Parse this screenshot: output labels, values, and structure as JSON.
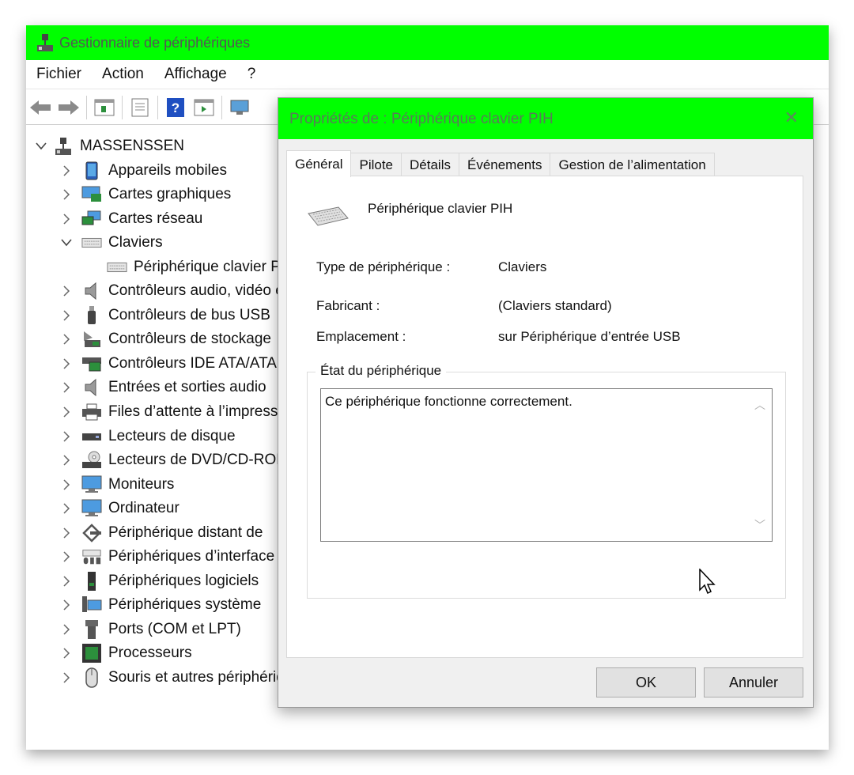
{
  "window": {
    "title": "Gestionnaire de périphériques",
    "accent": "#00ff00"
  },
  "menu": [
    "Fichier",
    "Action",
    "Affichage",
    "?"
  ],
  "toolbar": [
    "back-arrow-icon",
    "forward-arrow-icon",
    "properties-grid-icon",
    "document-icon",
    "help-icon",
    "run-panel-icon",
    "monitor-scan-icon"
  ],
  "tree": {
    "root": "MASSENSSEN",
    "items": [
      {
        "label": "Appareils mobiles",
        "icon": "phone-icon",
        "expanded": false
      },
      {
        "label": "Cartes graphiques",
        "icon": "display-adapter-icon",
        "expanded": false
      },
      {
        "label": "Cartes réseau",
        "icon": "network-icon",
        "expanded": false
      },
      {
        "label": "Claviers",
        "icon": "keyboard-icon",
        "expanded": true
      },
      {
        "label": "Périphérique clavier PIH",
        "icon": "keyboard-icon",
        "child": true
      },
      {
        "label": "Contrôleurs audio, vidéo et jeu",
        "icon": "speaker-icon",
        "expanded": false
      },
      {
        "label": "Contrôleurs de bus USB",
        "icon": "usb-icon",
        "expanded": false
      },
      {
        "label": "Contrôleurs de stockage",
        "icon": "storage-icon",
        "expanded": false
      },
      {
        "label": "Contrôleurs IDE ATA/ATAPI",
        "icon": "ide-icon",
        "expanded": false
      },
      {
        "label": "Entrées et sorties audio",
        "icon": "speaker-icon",
        "expanded": false
      },
      {
        "label": "Files d’attente à l’impression",
        "icon": "printer-icon",
        "expanded": false
      },
      {
        "label": "Lecteurs de disque",
        "icon": "disk-icon",
        "expanded": false
      },
      {
        "label": "Lecteurs de DVD/CD-ROM",
        "icon": "dvd-icon",
        "expanded": false
      },
      {
        "label": "Moniteurs",
        "icon": "monitor-icon",
        "expanded": false
      },
      {
        "label": "Ordinateur",
        "icon": "monitor-icon",
        "expanded": false
      },
      {
        "label": "Périphérique distant de ",
        "icon": "remote-icon",
        "expanded": false
      },
      {
        "label": "Périphériques d’interface",
        "icon": "hid-icon",
        "expanded": false
      },
      {
        "label": "Périphériques logiciels",
        "icon": "software-device-icon",
        "expanded": false
      },
      {
        "label": "Périphériques système",
        "icon": "system-device-icon",
        "expanded": false
      },
      {
        "label": "Ports (COM et LPT)",
        "icon": "port-icon",
        "expanded": false
      },
      {
        "label": "Processeurs",
        "icon": "processor-icon",
        "expanded": false
      },
      {
        "label": "Souris et autres périphériques",
        "icon": "mouse-icon",
        "expanded": false
      }
    ]
  },
  "dialog": {
    "title": "Propriétés de : Périphérique clavier PIH",
    "close": "✕",
    "tabs": [
      "Général",
      "Pilote",
      "Détails",
      "Événements",
      "Gestion de l’alimentation"
    ],
    "device_name": "Périphérique clavier PIH",
    "props": [
      {
        "label": "Type de périphérique :",
        "value": "Claviers"
      },
      {
        "label": "Fabricant :",
        "value": "(Claviers standard)"
      },
      {
        "label": "Emplacement :",
        "value": "sur Périphérique d’entrée USB"
      }
    ],
    "status_group": "État du périphérique",
    "status_text": "Ce périphérique fonctionne correctement.",
    "ok": "OK",
    "cancel": "Annuler"
  }
}
